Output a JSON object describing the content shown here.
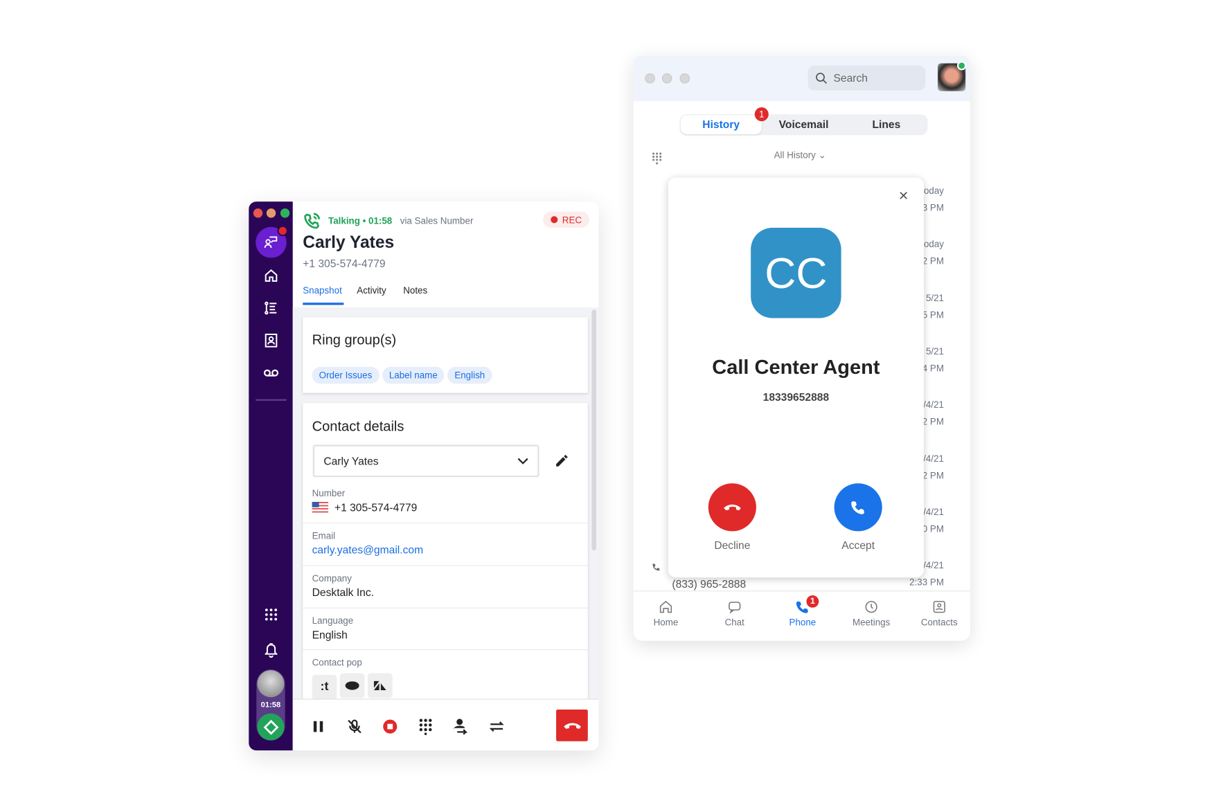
{
  "dialer": {
    "status": "Talking • 01:58",
    "via": "via Sales Number",
    "rec": "REC",
    "contact_name": "Carly Yates",
    "contact_number": "+1 305-574-4779",
    "tabs": [
      "Snapshot",
      "Activity",
      "Notes"
    ],
    "active_tab": "Snapshot",
    "ring_groups": {
      "title": "Ring group(s)",
      "chips": [
        "Order Issues",
        "Label name",
        "English"
      ]
    },
    "contact_details": {
      "title": "Contact details",
      "selected_contact": "Carly Yates",
      "number_label": "Number",
      "number": "+1 305-574-4779",
      "email_label": "Email",
      "email": "carly.yates@gmail.com",
      "company_label": "Company",
      "company": "Desktalk Inc.",
      "language_label": "Language",
      "language": "English",
      "contact_pop_label": "Contact pop",
      "contact_pop": [
        "talkdesk",
        "salesforce",
        "zendesk"
      ]
    },
    "sidebar": {
      "timer": "01:58"
    },
    "colors": {
      "sidebar": "#2b0657",
      "talking": "#20a357",
      "hangup": "#e02a2a",
      "accent": "#1a6ee3"
    }
  },
  "phone_app": {
    "search_placeholder": "Search",
    "tabs": [
      "History",
      "Voicemail",
      "Lines"
    ],
    "active_tab": "History",
    "history_badge": "1",
    "filter": "All History",
    "timestamps": [
      [
        "oday",
        "3 PM"
      ],
      [
        "oday",
        "2 PM"
      ],
      [
        "5/21",
        "5 PM"
      ],
      [
        "5/21",
        "4 PM"
      ],
      [
        "/4/21",
        "2 PM"
      ],
      [
        "/4/21",
        "2 PM"
      ],
      [
        "/4/21",
        "0 PM"
      ],
      [
        "/4/21",
        "2:33 PM"
      ]
    ],
    "last_entry_number": "(833) 965-2888",
    "incoming": {
      "initials": "CC",
      "name": "Call Center Agent",
      "number": "18339652888",
      "decline": "Decline",
      "accept": "Accept"
    },
    "nav": [
      {
        "label": "Home"
      },
      {
        "label": "Chat"
      },
      {
        "label": "Phone",
        "badge": "1"
      },
      {
        "label": "Meetings"
      },
      {
        "label": "Contacts"
      }
    ],
    "active_nav": "Phone",
    "colors": {
      "avatar": "#3192c7",
      "decline": "#e02a2a",
      "accept": "#1a73e8"
    }
  }
}
